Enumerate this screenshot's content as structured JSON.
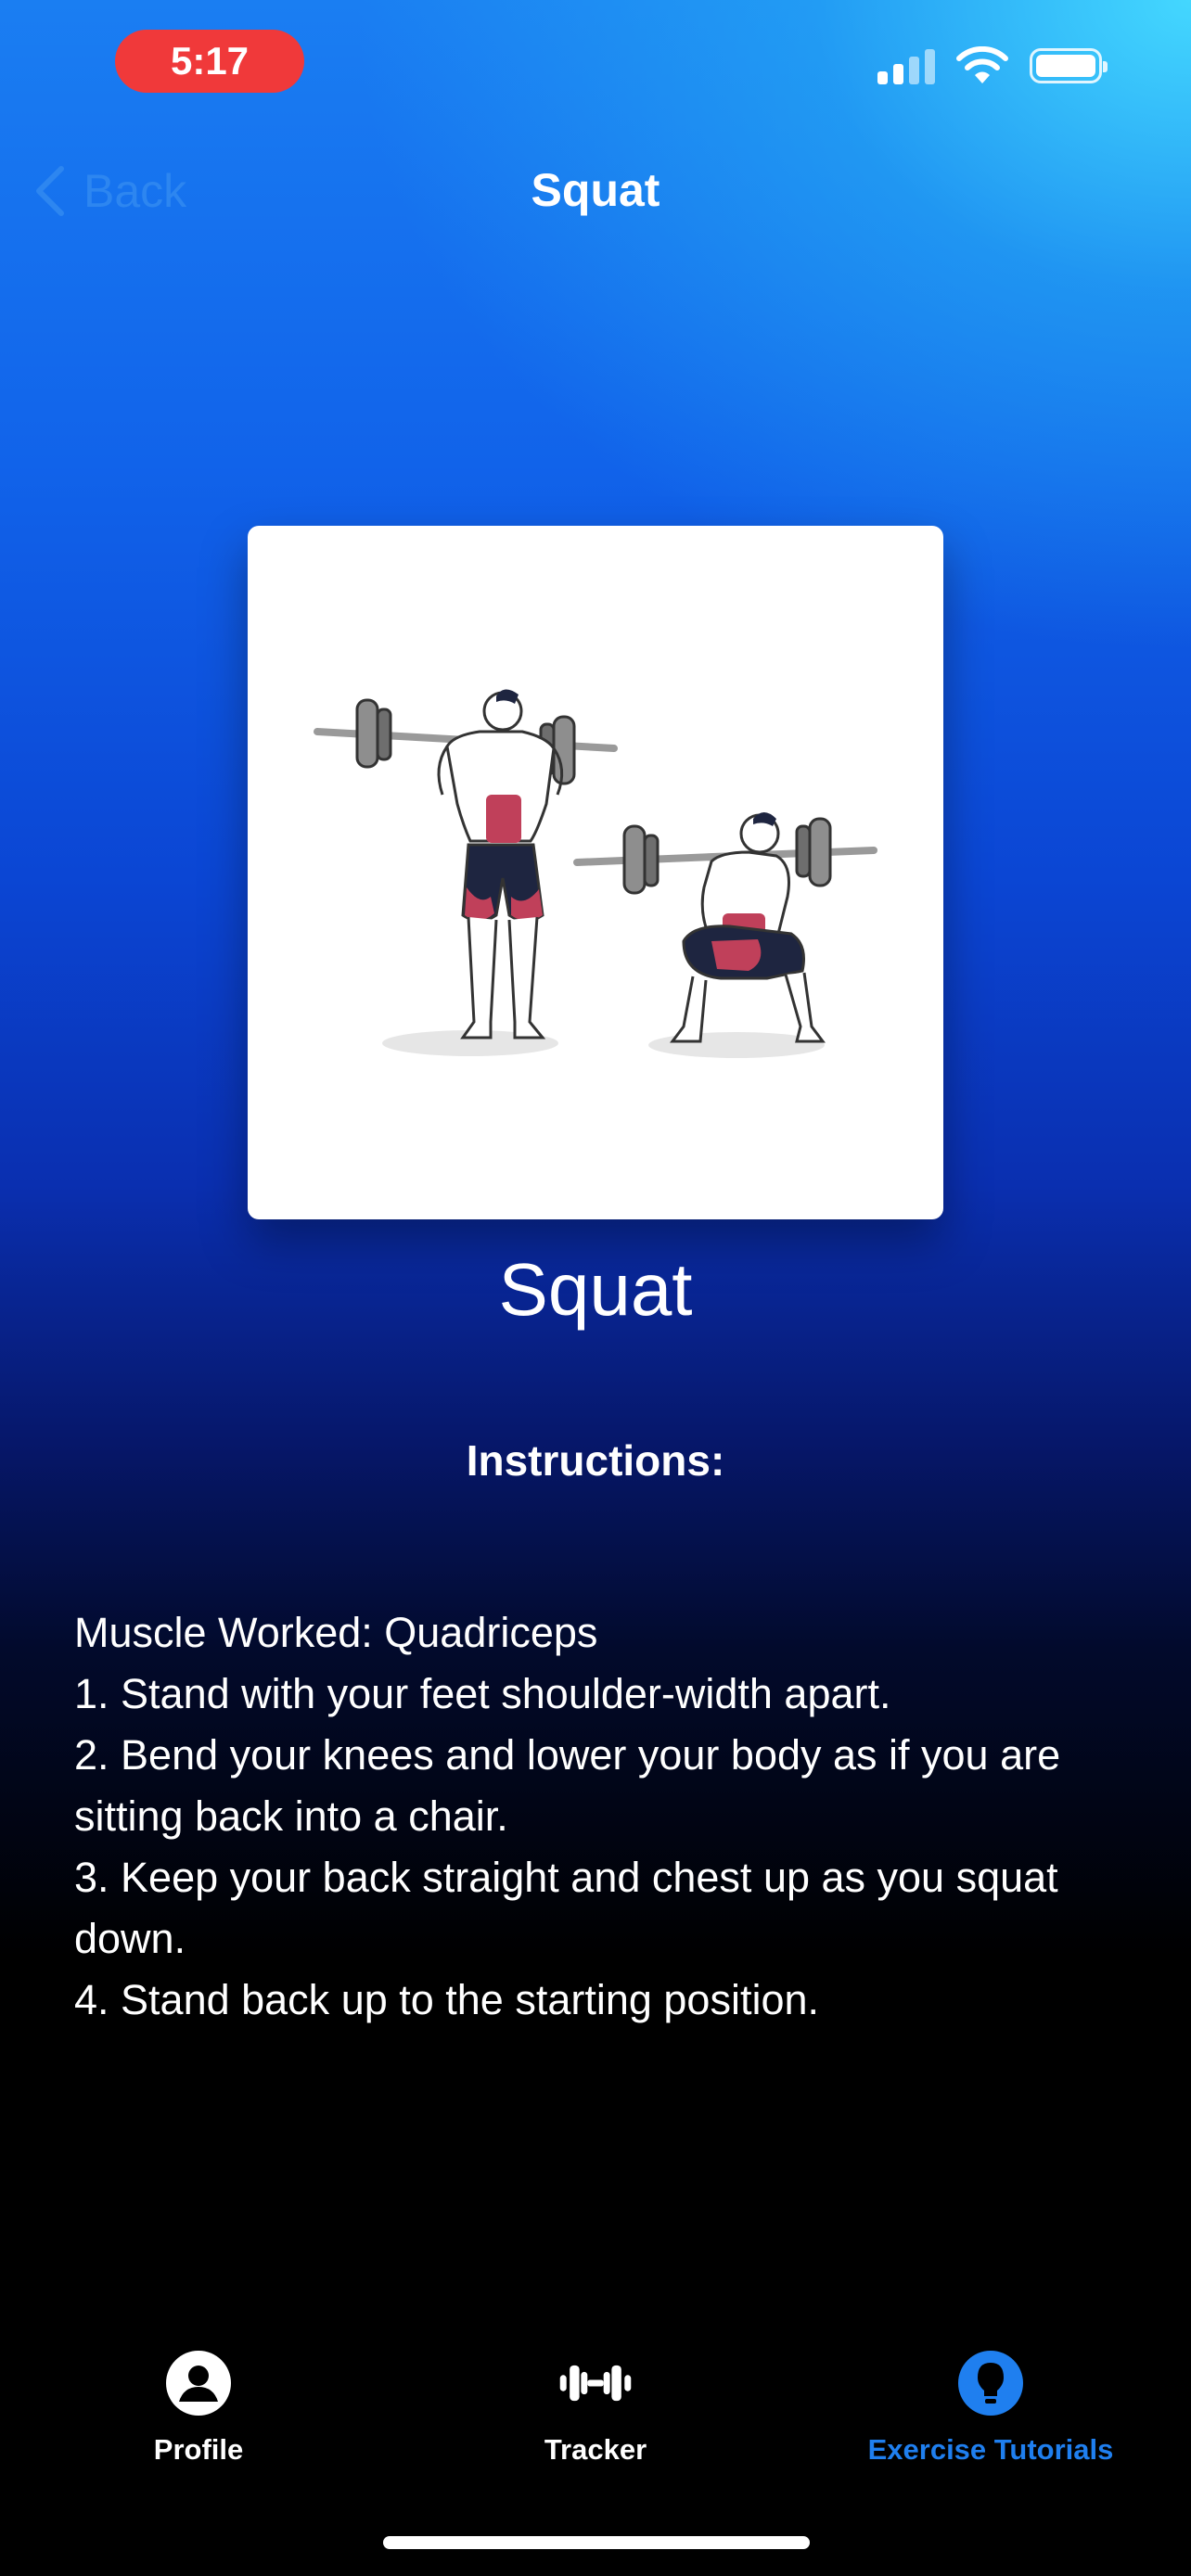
{
  "status_bar": {
    "time": "5:17",
    "signal_icon": "cellular-signal-icon",
    "wifi_icon": "wifi-icon",
    "battery_icon": "battery-icon"
  },
  "nav": {
    "back_label": "Back",
    "title": "Squat"
  },
  "exercise": {
    "illustration": "squat-illustration",
    "name": "Squat",
    "instructions_heading": "Instructions:",
    "instruction_lines": [
      "Muscle Worked: Quadriceps",
      "1. Stand with your feet shoulder-width apart.",
      "2. Bend your knees and lower your body as if you are sitting back into a chair.",
      "3. Keep your back straight and chest up as you squat down.",
      "4. Stand back up to the starting position."
    ]
  },
  "tab_bar": {
    "tabs": [
      {
        "label": "Profile",
        "icon": "person-circle-icon",
        "active": false
      },
      {
        "label": "Tracker",
        "icon": "dumbbell-icon",
        "active": false
      },
      {
        "label": "Exercise Tutorials",
        "icon": "lightbulb-icon",
        "active": true
      }
    ]
  },
  "colors": {
    "accent": "#1f7fef",
    "time_pill": "#f0393a",
    "back_link": "#2d86f0"
  }
}
